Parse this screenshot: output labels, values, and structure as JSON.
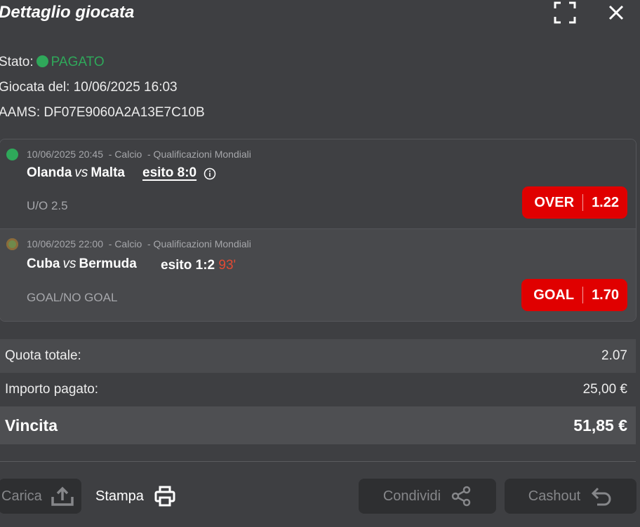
{
  "header": {
    "title": "Dettaglio giocata"
  },
  "info": {
    "stato_label": "Stato:",
    "stato_value": "PAGATO",
    "giocata_label": "Giocata del:",
    "giocata_value": "10/06/2025 16:03",
    "aams_label": "AAMS:",
    "aams_value": "DF07E9060A2A13E7C10B"
  },
  "events": [
    {
      "meta": "10/06/2025 20:45  - Calcio  - Qualificazioni Mondiali",
      "home": "Olanda",
      "vs": "vs",
      "away": "Malta",
      "esito": "esito 8:0",
      "minute": "",
      "market": "U/O 2.5",
      "selection": "OVER",
      "odd": "1.22",
      "status_color": "#2fa85a"
    },
    {
      "meta": "10/06/2025 22:00  - Calcio  - Qualificazioni Mondiali",
      "home": "Cuba",
      "vs": "vs",
      "away": "Bermuda",
      "esito": "esito 1:2",
      "minute": "93'",
      "market": "GOAL/NO GOAL",
      "selection": "GOAL",
      "odd": "1.70",
      "status_color": "#6f8a4c"
    }
  ],
  "summary": {
    "quota_label": "Quota totale:",
    "quota_value": "2.07",
    "importo_label": "Importo pagato:",
    "importo_value": "25,00 €",
    "vincita_label": "Vincita",
    "vincita_value": "51,85 €"
  },
  "actions": {
    "carica": "Carica",
    "stampa": "Stampa",
    "condividi": "Condividi",
    "cashout": "Cashout"
  },
  "colors": {
    "background": "#3e3f42",
    "accent_red": "#e00000",
    "status_green": "#2fa85a",
    "minute_red": "#e24a33"
  },
  "icons": [
    "expand-icon",
    "close-icon",
    "info-icon",
    "upload-icon",
    "printer-icon",
    "share-icon",
    "undo-icon"
  ]
}
